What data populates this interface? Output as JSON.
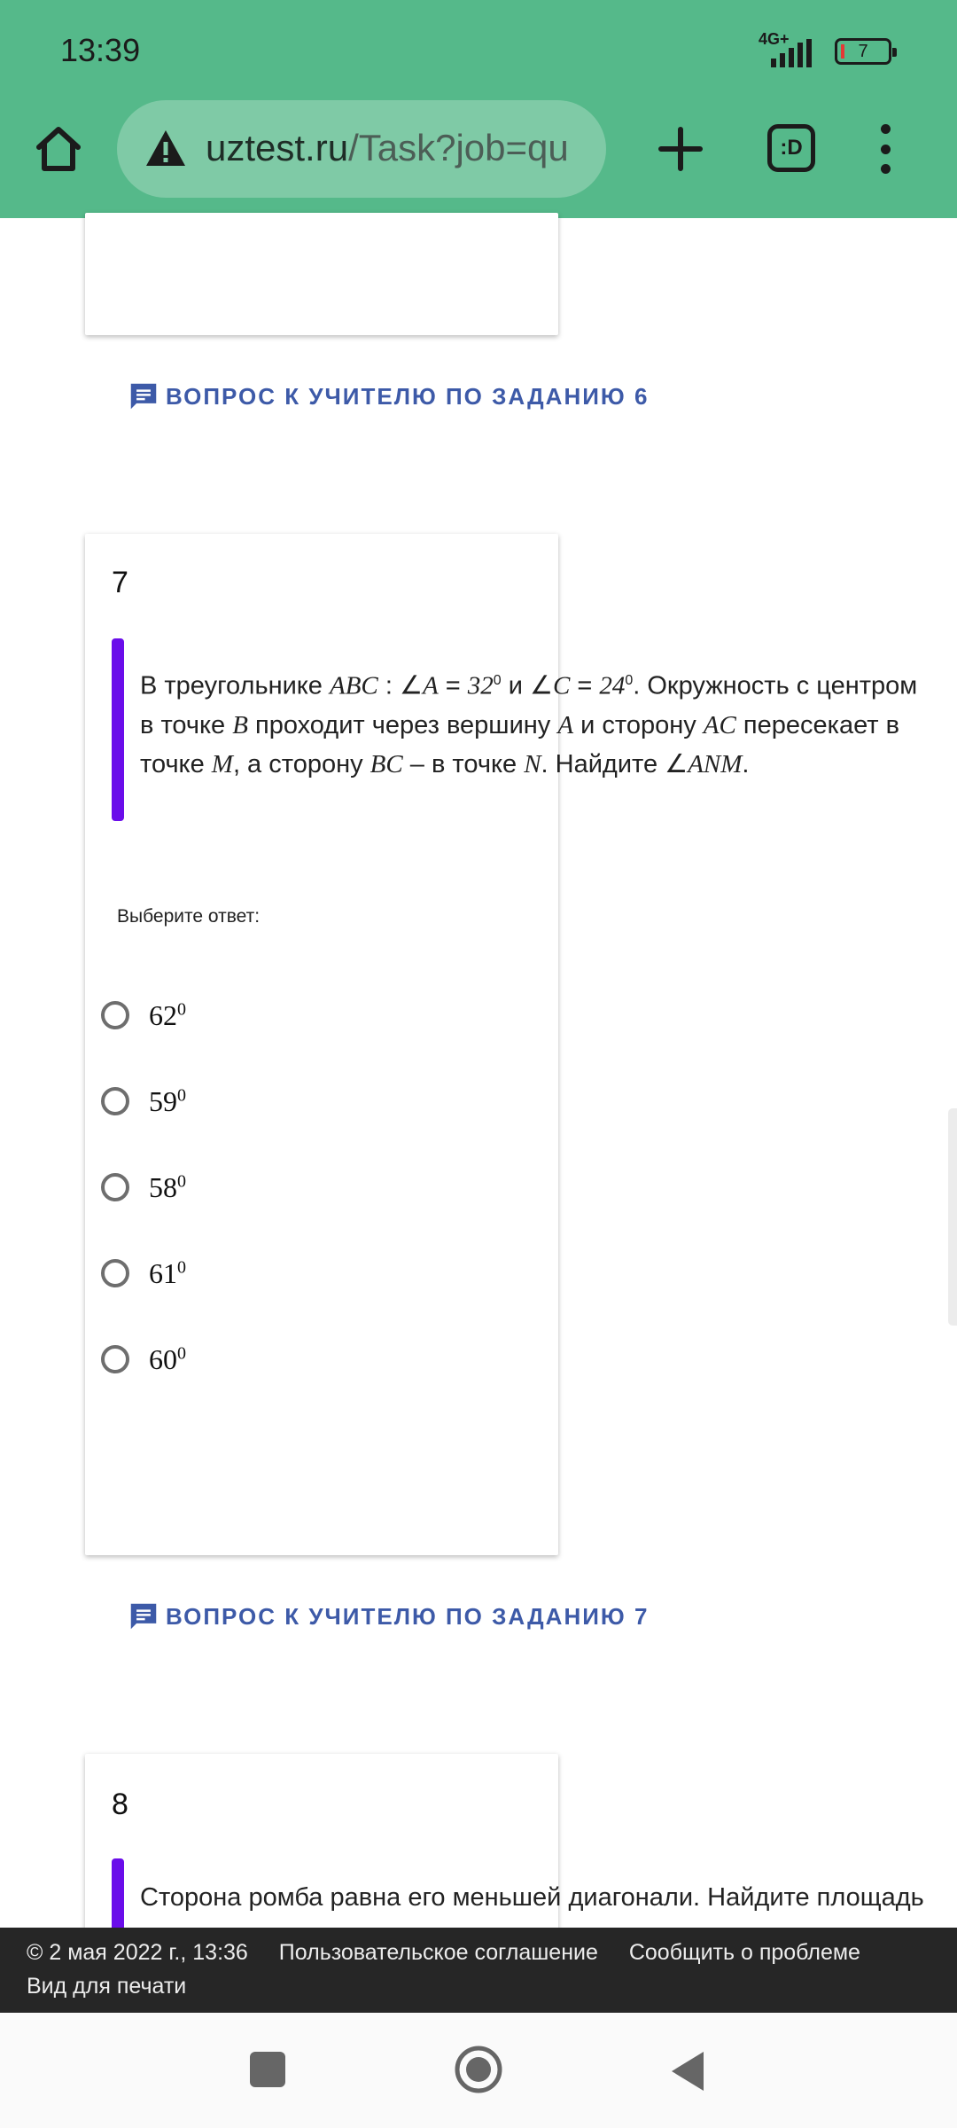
{
  "status": {
    "time": "13:39",
    "network": "4G+",
    "battery": "7"
  },
  "browser": {
    "url_host": "uztest.ru",
    "url_rest": "/Task?job=qu",
    "tabs_label": ":D"
  },
  "task6": {
    "ask_label": "ВОПРОС К УЧИТЕЛЮ ПО ЗАДАНИЮ 6"
  },
  "task7": {
    "number": "7",
    "q": {
      "p1": "В треугольнике ",
      "abc": "ABC",
      "p2": " : ∠",
      "a": "A",
      "p3": " = ",
      "v32": "32",
      "deg1": "0",
      "p4": " и ∠",
      "c": "C",
      "p5": " = ",
      "v24": "24",
      "deg2": "0",
      "p6": ". Окружность с центром в точке ",
      "b": "B",
      "p7": " проходит через вершину ",
      "a2": "A",
      "p8": " и сторону ",
      "ac": "AC",
      "p9": " пересекает в точке ",
      "m": "M",
      "p10": ", а сторону ",
      "bc": "BC",
      "p11": " – в точке ",
      "n": "N",
      "p12": ". Найдите ∠",
      "anm": "ANM",
      "p13": "."
    },
    "choose_label": "Выберите ответ:",
    "options": [
      {
        "value": "62",
        "sup": "0"
      },
      {
        "value": "59",
        "sup": "0"
      },
      {
        "value": "58",
        "sup": "0"
      },
      {
        "value": "61",
        "sup": "0"
      },
      {
        "value": "60",
        "sup": "0"
      }
    ],
    "ask_label": "ВОПРОС К УЧИТЕЛЮ ПО ЗАДАНИЮ 7"
  },
  "task8": {
    "number": "8",
    "question_partial": "Сторона ромба равна его меньшей диагонали. Найдите площадь"
  },
  "footer": {
    "copyright": "© 2 мая 2022 г., 13:36",
    "agreement": "Пользовательское соглашение",
    "report": "Сообщить о проблеме",
    "print": "Вид для печати"
  },
  "colors": {
    "toolbar": "#55b98a",
    "accent_bar": "#6a0dea",
    "link": "#3d5aa8",
    "footer": "#262626"
  }
}
